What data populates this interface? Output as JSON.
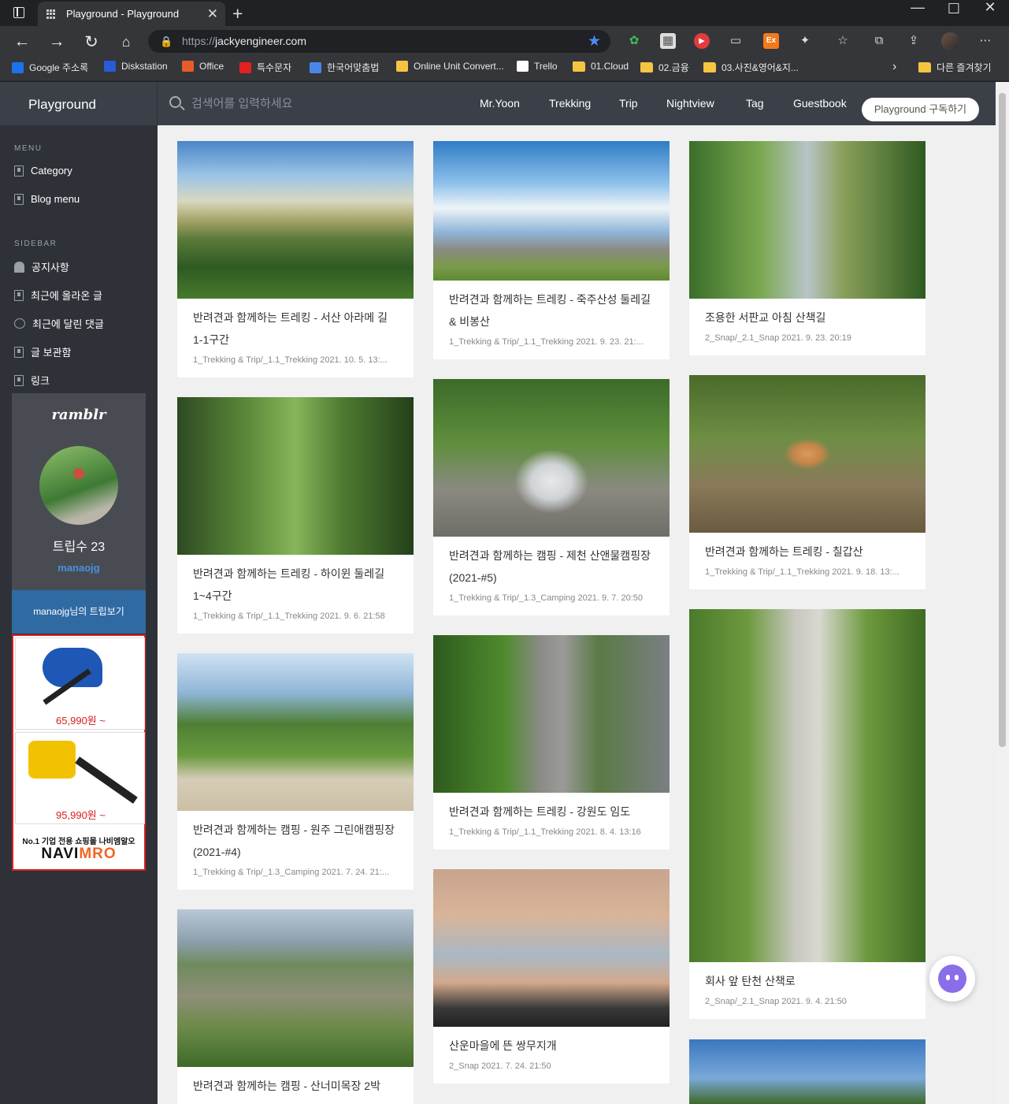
{
  "browser": {
    "tab_title": "Playground - Playground",
    "url_prefix": "https://",
    "url_host": "jackyengineer.com",
    "bookmarks": [
      {
        "label": "Google 주소록",
        "color": "#1a73e8"
      },
      {
        "label": "Diskstation",
        "color": "#2a5bd7"
      },
      {
        "label": "Office",
        "color": "#e85c2a"
      },
      {
        "label": "특수문자",
        "color": "#e32020"
      },
      {
        "label": "한국어맞춤법",
        "color": "#4a86e8"
      },
      {
        "label": "Online Unit Convert...",
        "color": "#f5c542"
      },
      {
        "label": "Trello",
        "color": "#ffffff"
      },
      {
        "label": "01.Cloud",
        "color": "#f5c542"
      },
      {
        "label": "02.금융",
        "color": "#f5c542"
      },
      {
        "label": "03.사진&영어&지...",
        "color": "#f5c542"
      }
    ],
    "other_bookmarks": "다른 즐겨찾기"
  },
  "header": {
    "site_title": "Playground",
    "search_placeholder": "검색어를 입력하세요",
    "nav": [
      "Mr.Yoon",
      "Trekking",
      "Trip",
      "Nightview",
      "Tag",
      "Guestbook"
    ],
    "subscribe": "Playground 구독하기"
  },
  "sidebar": {
    "menu_label": "MENU",
    "menu": [
      "Category",
      "Blog menu"
    ],
    "sidebar_label": "SIDEBAR",
    "items": [
      "공지사항",
      "최근에 올라온 글",
      "최근에 달린 댓글",
      "글 보관함",
      "링크"
    ],
    "widget": {
      "brand": "ramblr",
      "trips": "트립수 23",
      "user": "manaojg",
      "button": "manaojg님의 트립보기"
    },
    "ad": {
      "price1": "65,990원 ~",
      "price2": "95,990원 ~",
      "text": "No.1 기업 전용 쇼핑몰 나비엠알오",
      "logo": "NAVIMRO"
    }
  },
  "cards": [
    {
      "title": "반려견과 함께하는 트레킹 - 서산 아라메 길 1-1구간",
      "meta": "1_Trekking & Trip/_1.1_Trekking   2021. 10. 5. 13:..."
    },
    {
      "title": "반려견과 함께하는 트레킹 - 하이윈 둘레길 1~4구간",
      "meta": "1_Trekking & Trip/_1.1_Trekking   2021. 9. 6. 21:58"
    },
    {
      "title": "반려견과 함께하는 캠핑 - 원주 그린애캠핑장(2021-#4)",
      "meta": "1_Trekking & Trip/_1.3_Camping   2021. 7. 24. 21:..."
    },
    {
      "title": "반려견과 함께하는 캠핑 - 산너미목장 2박",
      "meta": ""
    },
    {
      "title": "반려견과 함께하는 트레킹 - 죽주산성 둘레길 & 비봉산",
      "meta": "1_Trekking & Trip/_1.1_Trekking   2021. 9. 23. 21:..."
    },
    {
      "title": "반려견과 함께하는 캠핑 - 제천 산앤물캠핑장(2021-#5)",
      "meta": "1_Trekking & Trip/_1.3_Camping   2021. 9. 7. 20:50"
    },
    {
      "title": "반려견과 함께하는 트레킹 - 강원도 임도",
      "meta": "1_Trekking & Trip/_1.1_Trekking   2021. 8. 4. 13:16"
    },
    {
      "title": "산운마을에 뜬 쌍무지개",
      "meta": "2_Snap   2021. 7. 24. 21:50"
    },
    {
      "title": "조용한 서판교 아침 산책길",
      "meta": "2_Snap/_2.1_Snap   2021. 9. 23. 20:19"
    },
    {
      "title": "반려견과 함께하는 트레킹 - 칠갑산",
      "meta": "1_Trekking & Trip/_1.1_Trekking   2021. 9. 18. 13:..."
    },
    {
      "title": "회사 앞 탄천 산책로",
      "meta": "2_Snap/_2.1_Snap   2021. 9. 4. 21:50"
    }
  ]
}
